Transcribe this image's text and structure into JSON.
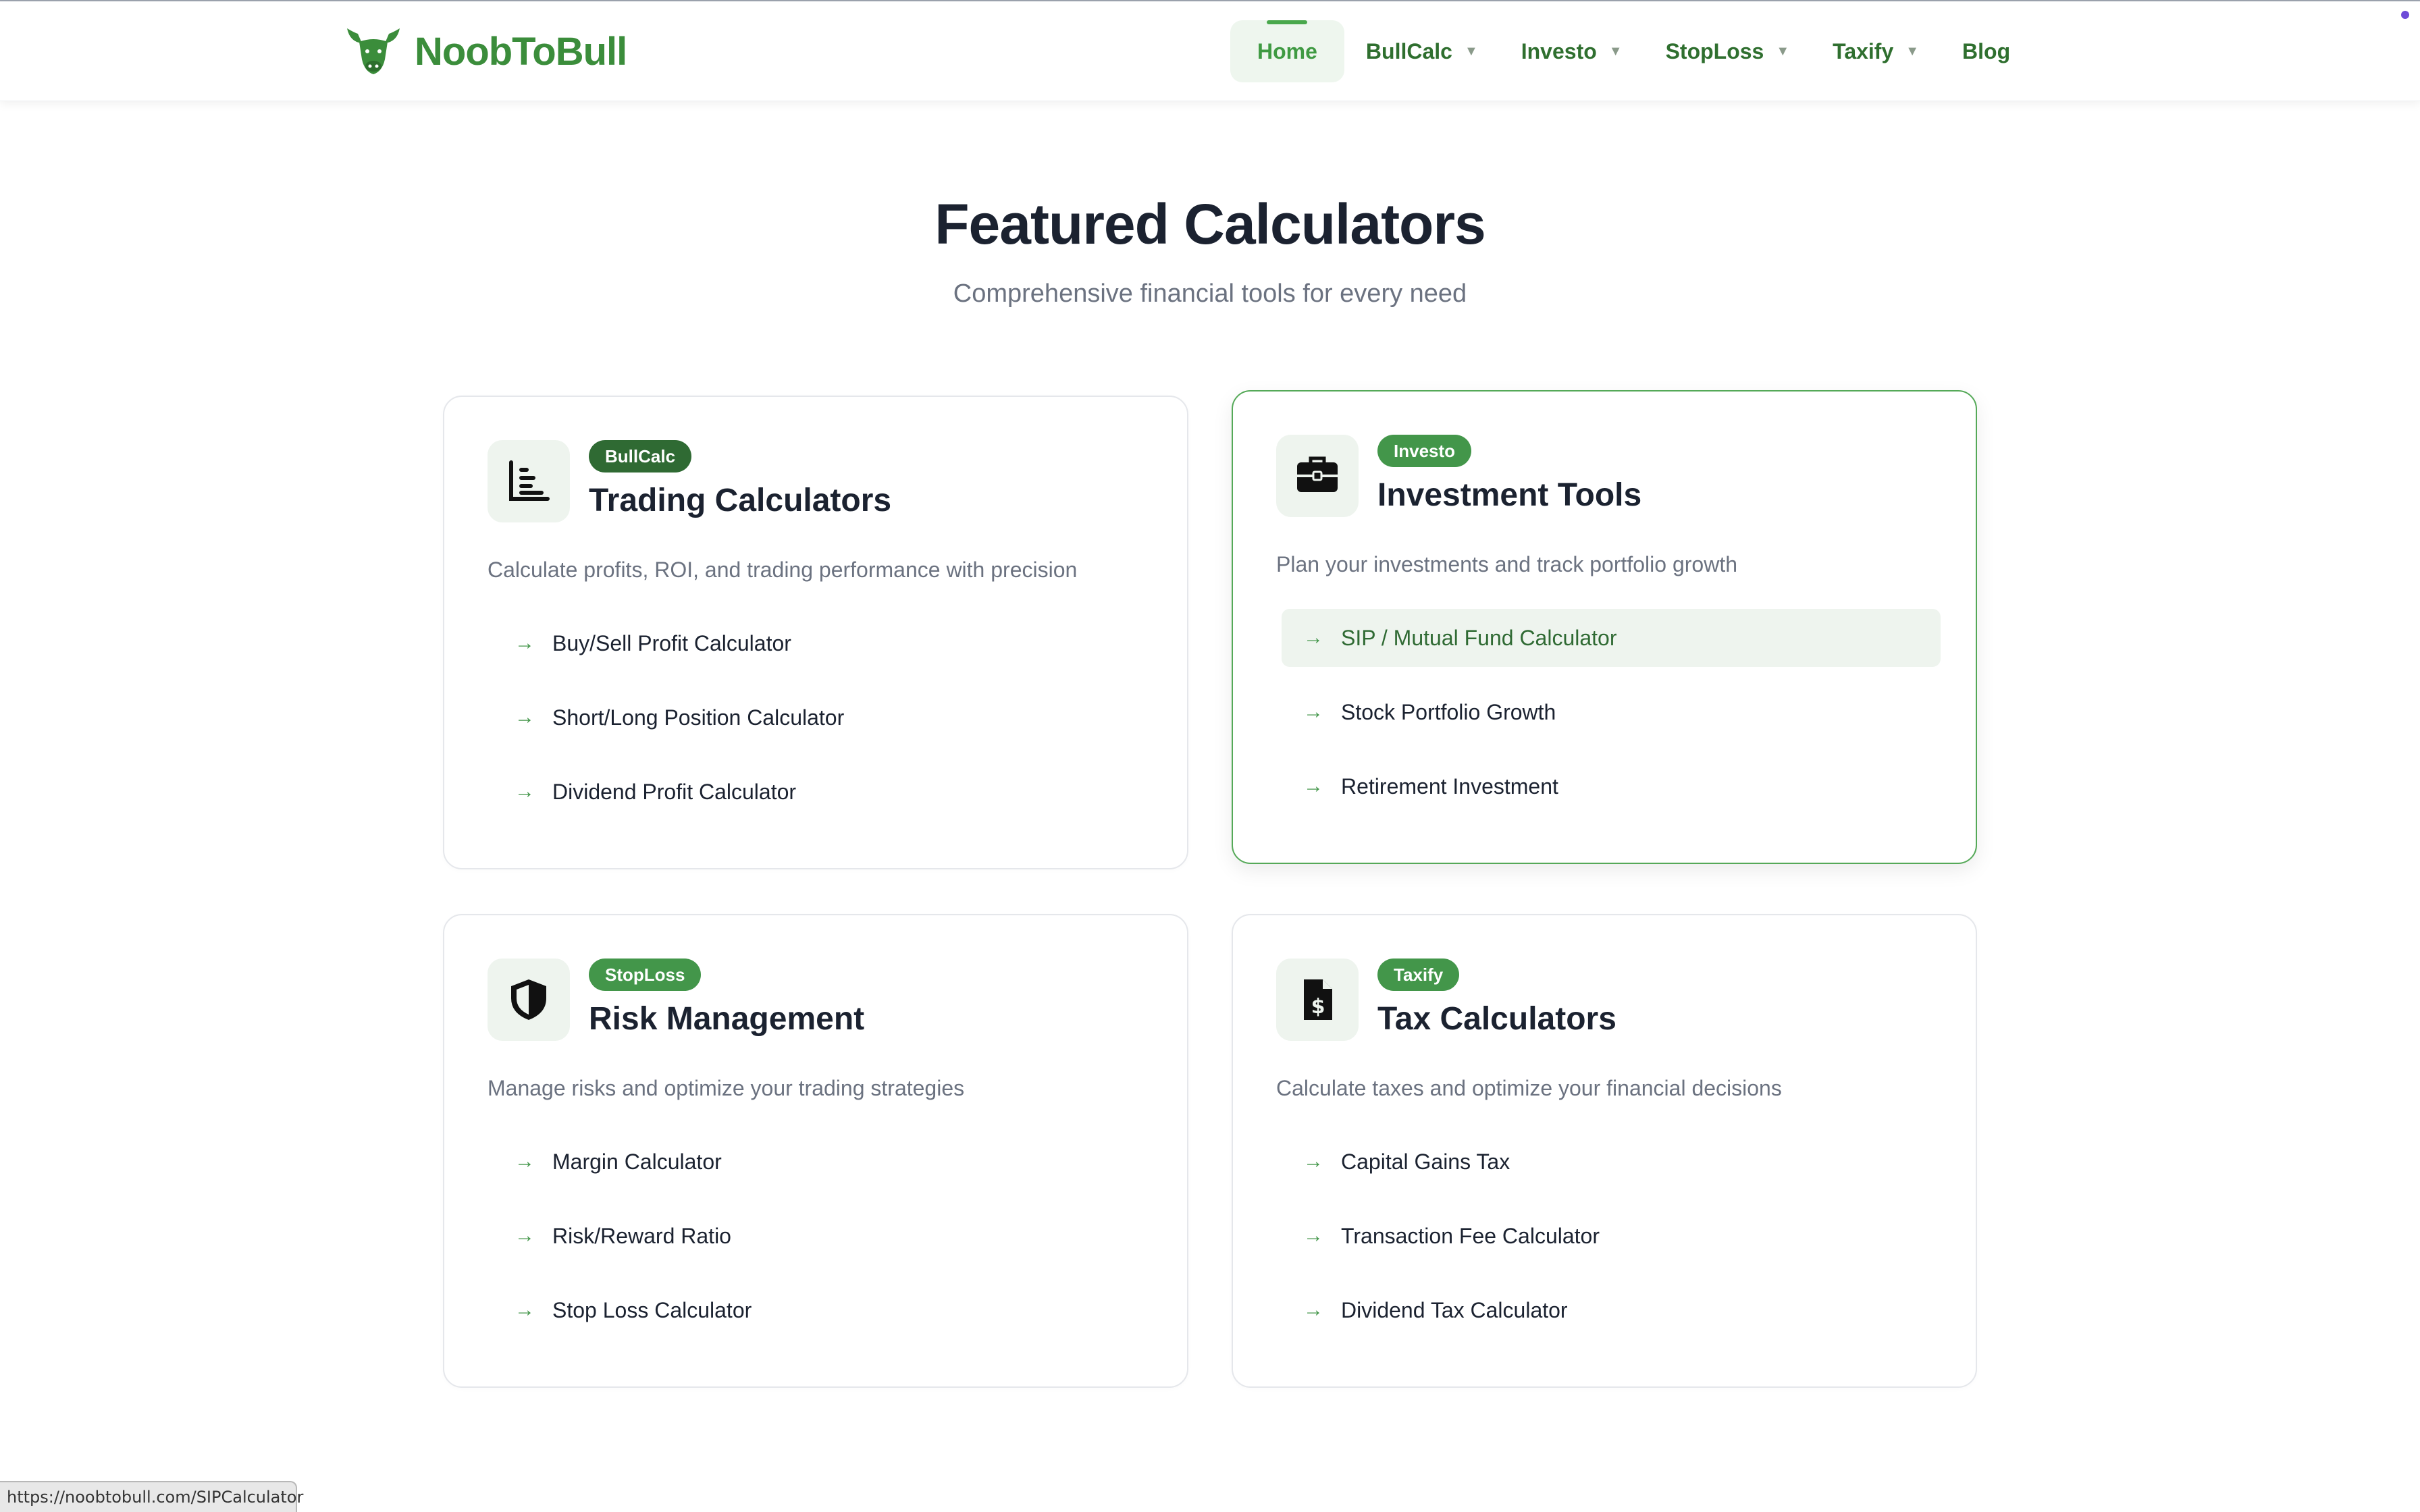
{
  "header": {
    "logo_text": "NoobToBull",
    "nav": [
      {
        "label": "Home"
      },
      {
        "label": "BullCalc"
      },
      {
        "label": "Investo"
      },
      {
        "label": "StopLoss"
      },
      {
        "label": "Taxify"
      },
      {
        "label": "Blog"
      }
    ]
  },
  "hero": {
    "title": "Featured Calculators",
    "subtitle": "Comprehensive financial tools for every need"
  },
  "cards": [
    {
      "badge": "BullCalc",
      "title": "Trading Calculators",
      "description": "Calculate profits, ROI, and trading performance with precision",
      "icon": "bar-chart-icon",
      "links": [
        "Buy/Sell Profit Calculator",
        "Short/Long Position Calculator",
        "Dividend Profit Calculator"
      ]
    },
    {
      "badge": "Investo",
      "title": "Investment Tools",
      "description": "Plan your investments and track portfolio growth",
      "icon": "briefcase-icon",
      "links": [
        "SIP / Mutual Fund Calculator",
        "Stock Portfolio Growth",
        "Retirement Investment"
      ]
    },
    {
      "badge": "StopLoss",
      "title": "Risk Management",
      "description": "Manage risks and optimize your trading strategies",
      "icon": "shield-icon",
      "links": [
        "Margin Calculator",
        "Risk/Reward Ratio",
        "Stop Loss Calculator"
      ]
    },
    {
      "badge": "Taxify",
      "title": "Tax Calculators",
      "description": "Calculate taxes and optimize your financial decisions",
      "icon": "tax-document-icon",
      "links": [
        "Capital Gains Tax",
        "Transaction Fee Calculator",
        "Dividend Tax Calculator"
      ]
    }
  ],
  "statusbar": {
    "url": "https://noobtobull.com/SIPCalculator"
  },
  "colors": {
    "brand_green": "#3b8d3b",
    "badge_green": "#43964a",
    "badge_dark_green": "#2f6a33",
    "hover_bg": "#eef4ee",
    "highlight_border": "#55a958"
  }
}
